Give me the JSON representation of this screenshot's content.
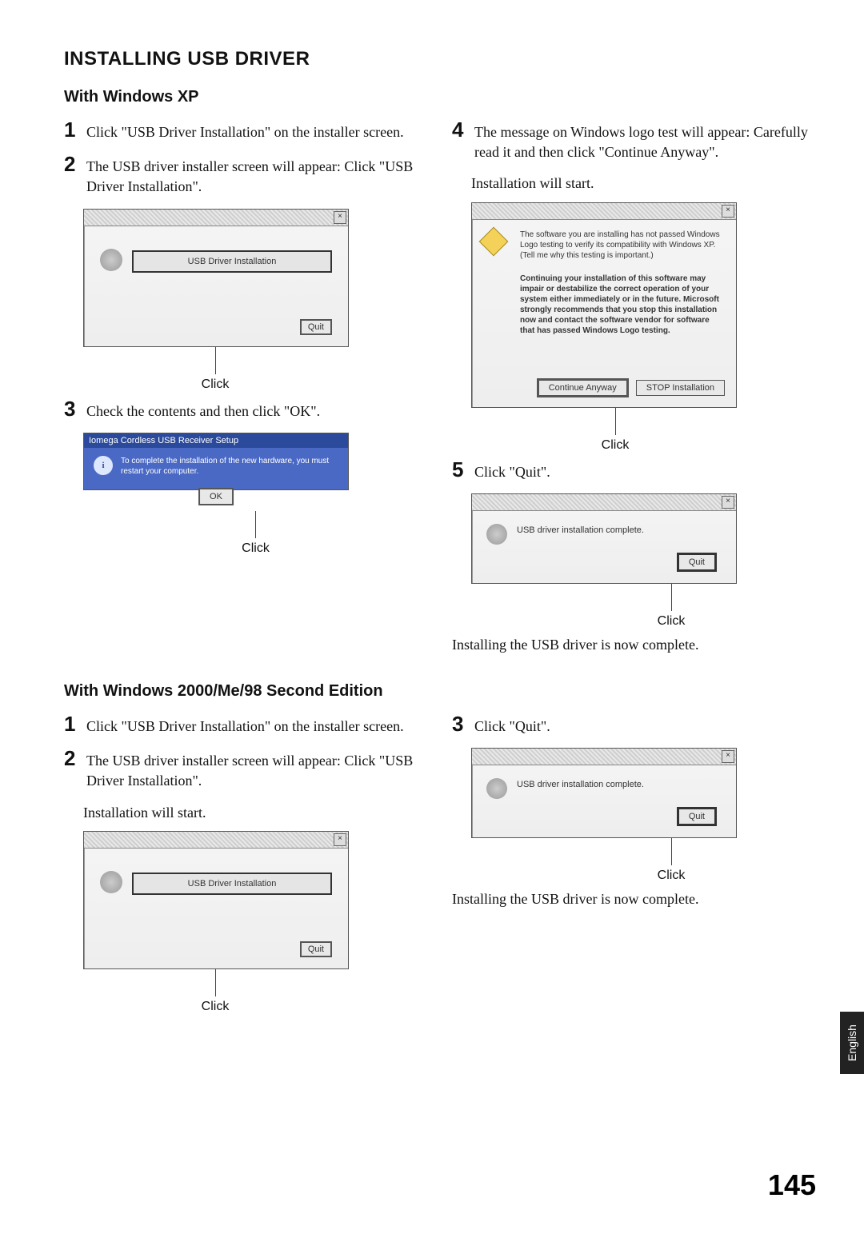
{
  "title": "INSTALLING USB DRIVER",
  "page_number": "145",
  "language_tab": "English",
  "click_label": "Click",
  "xp": {
    "heading": "With Windows XP",
    "steps": {
      "1": "Click \"USB Driver Installation\" on the installer screen.",
      "2": "The USB driver installer screen will appear: Click \"USB Driver Installation\".",
      "3": "Check the contents and then click \"OK\".",
      "4": "The message on Windows logo test will appear: Carefully read it and then click \"Continue Anyway\".",
      "4b": "Installation will start.",
      "5": "Click \"Quit\".",
      "done": "Installing the USB driver is now complete."
    },
    "figA": {
      "button": "USB Driver Installation",
      "quit": "Quit"
    },
    "figB": {
      "title": "Iomega Cordless USB Receiver Setup",
      "msg": "To complete the installation of the new hardware, you must restart your computer.",
      "ok": "OK"
    },
    "figC": {
      "txt1": "The software you are installing has not passed Windows Logo testing to verify its compatibility with Windows XP. (Tell me why this testing is important.)",
      "txt2": "Continuing your installation of this software may impair or destabilize the correct operation of your system either immediately or in the future. Microsoft strongly recommends that you stop this installation now and contact the software vendor for software that has passed Windows Logo testing.",
      "continue": "Continue Anyway",
      "stop": "STOP Installation"
    },
    "figD": {
      "msg": "USB driver installation complete.",
      "quit": "Quit"
    }
  },
  "w2k": {
    "heading": "With Windows 2000/Me/98 Second Edition",
    "steps": {
      "1": "Click \"USB Driver Installation\" on the installer screen.",
      "2": "The USB driver installer screen will appear: Click \"USB Driver Installation\".",
      "2b": "Installation will start.",
      "3": "Click \"Quit\".",
      "done": "Installing the USB driver is now complete."
    },
    "figE": {
      "button": "USB Driver Installation",
      "quit": "Quit"
    },
    "figF": {
      "msg": "USB driver installation complete.",
      "quit": "Quit"
    }
  }
}
